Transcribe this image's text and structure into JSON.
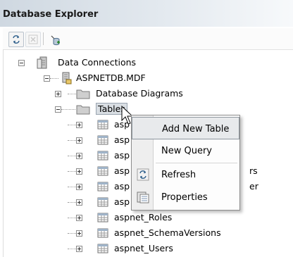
{
  "window": {
    "title": "Database Explorer"
  },
  "toolbar": {
    "buttons": [
      {
        "icon": "refresh-icon"
      },
      {
        "icon": "stop-icon"
      },
      {
        "icon": "connect-to-database-icon"
      }
    ]
  },
  "tree": {
    "data_connections": "Data Connections",
    "database": "ASPNETDB.MDF",
    "folders": {
      "diagrams": "Database Diagrams",
      "tables": "Tables"
    },
    "tables": [
      "aspnet_Applications",
      "aspnet_Membership",
      "aspnet_Paths",
      "aspnet_PersonalizationAllUsers",
      "aspnet_PersonalizationPerUser",
      "aspnet_Profile",
      "aspnet_Roles",
      "aspnet_SchemaVersions",
      "aspnet_Users"
    ],
    "tables_visible": [
      "asp",
      "asp",
      "asp",
      "asp",
      "asp",
      "asp",
      "aspnet_Roles",
      "aspnet_SchemaVersions",
      "aspnet_Users"
    ],
    "tables_suffix_visible": [
      "",
      "",
      "",
      "rs",
      "er",
      "",
      "",
      "",
      ""
    ]
  },
  "context_menu": {
    "items": [
      {
        "label": "Add New Table",
        "icon": "",
        "highlighted": true
      },
      {
        "label": "New Query",
        "icon": ""
      },
      {
        "label": "Refresh",
        "icon": "refresh-icon"
      },
      {
        "label": "Properties",
        "icon": "properties-icon"
      }
    ]
  }
}
